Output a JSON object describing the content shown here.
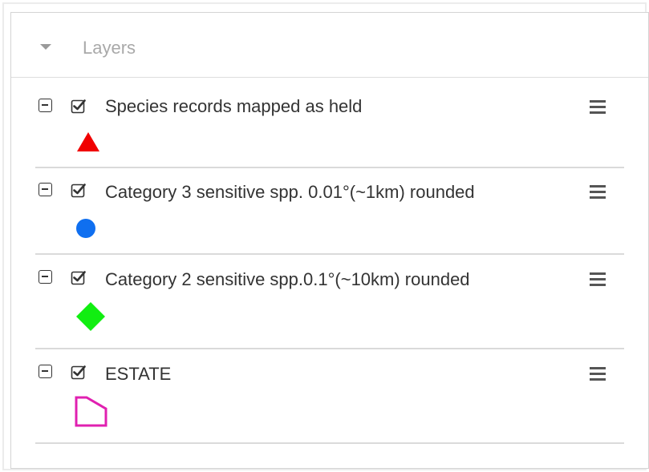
{
  "panel": {
    "title": "Layers",
    "collapse_icon": "caret-down-icon"
  },
  "layers": [
    {
      "name": "Species records mapped as held",
      "checked": true,
      "symbol": "triangle",
      "color": "#f00000"
    },
    {
      "name": "Category 3 sensitive spp. 0.01°(~1km) rounded",
      "checked": true,
      "symbol": "circle",
      "color": "#0f6ff0"
    },
    {
      "name": "Category 2 sensitive spp.0.1°(~10km) rounded",
      "checked": true,
      "symbol": "diamond",
      "color": "#11ee11"
    },
    {
      "name": "ESTATE",
      "checked": true,
      "symbol": "polygon-outline",
      "color": "#e020b0"
    }
  ]
}
